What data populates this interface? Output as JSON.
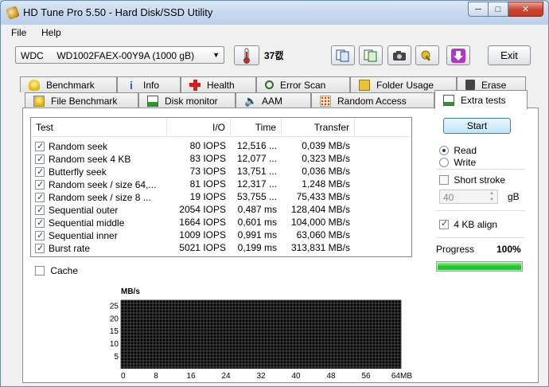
{
  "window": {
    "title": "HD Tune Pro 5.50 - Hard Disk/SSD Utility"
  },
  "menu": {
    "file": "File",
    "help": "Help"
  },
  "toolbar": {
    "drive": "WDC     WD1002FAEX-00Y9A (1000 gB)",
    "temperature": "37캢",
    "exit": "Exit"
  },
  "tabs_top": [
    "Benchmark",
    "Info",
    "Health",
    "Error Scan",
    "Folder Usage",
    "Erase"
  ],
  "tabs_bottom": [
    "File Benchmark",
    "Disk monitor",
    "AAM",
    "Random Access",
    "Extra tests"
  ],
  "grid": {
    "headers": {
      "test": "Test",
      "io": "I/O",
      "time": "Time",
      "transfer": "Transfer"
    },
    "rows": [
      {
        "test": "Random seek",
        "io": "80 IOPS",
        "time": "12,516 ...",
        "transfer": "0,039 MB/s",
        "checked": true
      },
      {
        "test": "Random seek 4 KB",
        "io": "83 IOPS",
        "time": "12,077 ...",
        "transfer": "0,323 MB/s",
        "checked": true
      },
      {
        "test": "Butterfly seek",
        "io": "73 IOPS",
        "time": "13,751 ...",
        "transfer": "0,036 MB/s",
        "checked": true
      },
      {
        "test": "Random seek / size 64,...",
        "io": "81 IOPS",
        "time": "12,317 ...",
        "transfer": "1,248 MB/s",
        "checked": true
      },
      {
        "test": "Random seek / size 8 ...",
        "io": "19 IOPS",
        "time": "53,755 ...",
        "transfer": "75,433 MB/s",
        "checked": true
      },
      {
        "test": "Sequential outer",
        "io": "2054 IOPS",
        "time": "0,487 ms",
        "transfer": "128,404 MB/s",
        "checked": true
      },
      {
        "test": "Sequential middle",
        "io": "1664 IOPS",
        "time": "0,601 ms",
        "transfer": "104,000 MB/s",
        "checked": true
      },
      {
        "test": "Sequential inner",
        "io": "1009 IOPS",
        "time": "0,991 ms",
        "transfer": "63,060 MB/s",
        "checked": true
      },
      {
        "test": "Burst rate",
        "io": "5021 IOPS",
        "time": "0,199 ms",
        "transfer": "313,831 MB/s",
        "checked": true
      }
    ]
  },
  "cache_label": "Cache",
  "controls": {
    "start": "Start",
    "read": "Read",
    "write": "Write",
    "short_stroke": "Short stroke",
    "stroke_value": "40",
    "stroke_unit": "gB",
    "align": "4 KB align",
    "progress_label": "Progress",
    "progress_text": "100%",
    "progress_value": 1.0
  },
  "chart_data": {
    "type": "area",
    "ylabel": "MB/s",
    "xunit": "MB",
    "yticks": [
      25,
      20,
      15,
      10,
      5
    ],
    "xticks": [
      "0",
      "8",
      "16",
      "24",
      "32",
      "40",
      "48",
      "56",
      "64MB"
    ],
    "ylim": [
      0,
      27
    ],
    "xlim": [
      0,
      64
    ],
    "grid": true,
    "series": []
  },
  "icons": {
    "benchmark": "lightbulb-icon",
    "info": "info-icon",
    "health": "red-cross-icon",
    "error_scan": "magnifier-icon",
    "folder_usage": "folder-icon",
    "erase": "trash-icon",
    "file_benchmark": "lightbulb-page-icon",
    "disk_monitor": "chart-icon",
    "aam": "speaker-icon",
    "random_access": "dots-grid-icon",
    "extra_tests": "chart-page-icon"
  }
}
